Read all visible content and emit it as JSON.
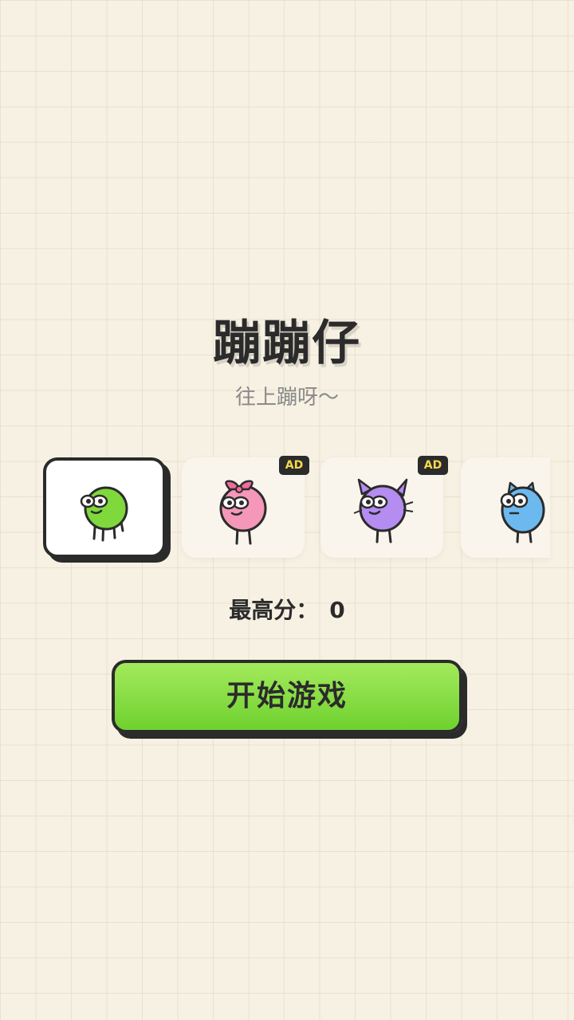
{
  "game": {
    "title": "蹦蹦仔",
    "subtitle": "往上蹦呀～"
  },
  "characters": [
    {
      "name": "green-blob",
      "color": "#7fd83c",
      "selected": true,
      "ad": false
    },
    {
      "name": "pink-bow-blob",
      "color": "#f497b8",
      "selected": false,
      "ad": true,
      "badge": "AD"
    },
    {
      "name": "purple-cat-blob",
      "color": "#b58cf0",
      "selected": false,
      "ad": true,
      "badge": "AD"
    },
    {
      "name": "blue-cat-blob",
      "color": "#6cb9f0",
      "selected": false,
      "ad": false
    }
  ],
  "best_score": {
    "label": "最高分：",
    "value": "0"
  },
  "start_button": {
    "label": "开始游戏",
    "color_top": "#a3ea5c",
    "color_bottom": "#6fd12f"
  }
}
